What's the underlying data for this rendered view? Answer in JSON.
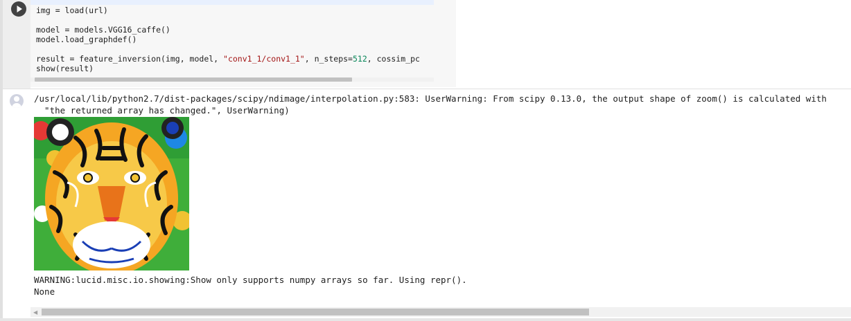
{
  "code_cell": {
    "lines": [
      "img = load(url)",
      "",
      "model = models.VGG16_caffe()",
      "model.load_graphdef()",
      "",
      "result = feature_inversion(img, model, \"conv1_1/conv1_1\", n_steps=512, cossim_pc",
      "show(result)"
    ],
    "result_line": {
      "prefix": "result = feature_inversion(img, model, ",
      "string_arg": "\"conv1_1/conv1_1\"",
      "middle": ", n_steps=",
      "number_arg": "512",
      "suffix": ", cossim_pc"
    },
    "run_button_icon": "play-icon"
  },
  "output": {
    "stderr_lines": [
      "/usr/local/lib/python2.7/dist-packages/scipy/ndimage/interpolation.py:583: UserWarning: From scipy 0.13.0, the output shape of zoom() is calculated with",
      "  \"the returned array has changed.\", UserWarning)"
    ],
    "image": "tiger feature inversion result",
    "log_lines": [
      "WARNING:lucid.misc.io.showing:Show only supports numpy arrays so far. Using repr().",
      "None"
    ],
    "avatar_icon": "output-avatar-icon"
  },
  "colors": {
    "string": "#a31515",
    "number": "#098658",
    "editor_bg": "#f7f7f7",
    "gutter_bg": "#eeeeee"
  }
}
